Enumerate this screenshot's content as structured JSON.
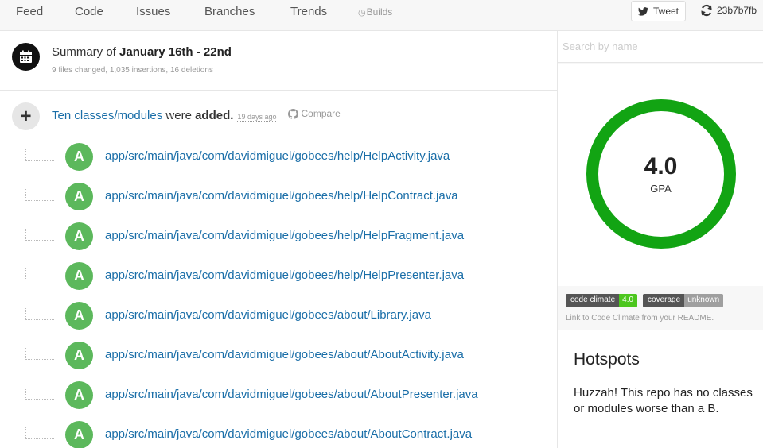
{
  "nav": {
    "tabs": [
      {
        "label": "Feed"
      },
      {
        "label": "Code"
      },
      {
        "label": "Issues"
      },
      {
        "label": "Branches"
      },
      {
        "label": "Trends"
      },
      {
        "label": "Builds"
      }
    ],
    "tweet_label": "Tweet",
    "commit_hash": "23b7b7fb"
  },
  "summary": {
    "prefix": "Summary of",
    "range": "January 16th - 22nd",
    "meta": "9 files changed, 1,035 insertions, 16 deletions"
  },
  "event": {
    "link_text": "Ten classes/modules",
    "mid_text": "were",
    "action": "added.",
    "ago": "19 days ago",
    "compare_label": "Compare",
    "badge_letter": "A",
    "files": [
      "app/src/main/java/com/davidmiguel/gobees/help/HelpActivity.java",
      "app/src/main/java/com/davidmiguel/gobees/help/HelpContract.java",
      "app/src/main/java/com/davidmiguel/gobees/help/HelpFragment.java",
      "app/src/main/java/com/davidmiguel/gobees/help/HelpPresenter.java",
      "app/src/main/java/com/davidmiguel/gobees/about/Library.java",
      "app/src/main/java/com/davidmiguel/gobees/about/AboutActivity.java",
      "app/src/main/java/com/davidmiguel/gobees/about/AboutPresenter.java",
      "app/src/main/java/com/davidmiguel/gobees/about/AboutContract.java"
    ]
  },
  "sidebar": {
    "search_placeholder": "Search by name",
    "gpa_value": "4.0",
    "gpa_label": "GPA",
    "gpa_ring_color": "#12a413",
    "badges": [
      {
        "key": "code climate",
        "value": "4.0",
        "color": "#4cc61e"
      },
      {
        "key": "coverage",
        "value": "unknown",
        "color": "#9f9f9f"
      }
    ],
    "badge_note": "Link to Code Climate from your README.",
    "hotspots_title": "Hotspots",
    "hotspots_text": "Huzzah! This repo has no classes or modules worse than a B."
  },
  "colors": {
    "link": "#1a6ea8",
    "added_badge": "#5cb85c"
  },
  "icons": {
    "calendar": "calendar-icon",
    "plus": "plus-icon",
    "twitter": "twitter-icon",
    "refresh": "refresh-icon",
    "github": "github-icon",
    "builds": "clock-icon"
  }
}
